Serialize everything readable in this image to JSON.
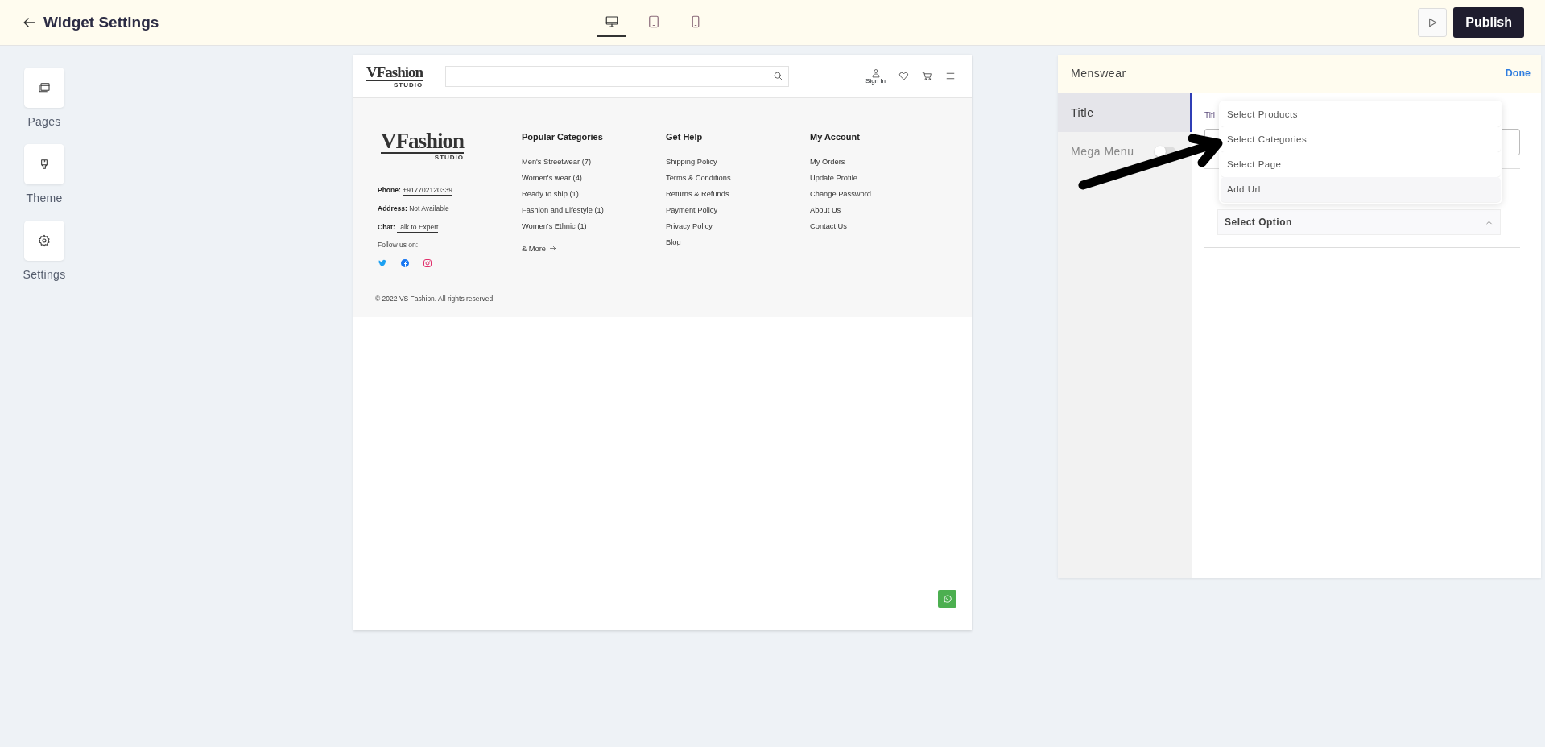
{
  "topbar": {
    "title": "Widget Settings",
    "devices": [
      {
        "kind": "desktop",
        "selected": true
      },
      {
        "kind": "tablet",
        "selected": false
      },
      {
        "kind": "mobile",
        "selected": false
      }
    ],
    "publish": "Publish"
  },
  "sidebar": [
    {
      "kind": "pages",
      "label": "Pages"
    },
    {
      "kind": "theme",
      "label": "Theme"
    },
    {
      "kind": "settings",
      "label": "Settings"
    }
  ],
  "preview": {
    "header_logo": {
      "name": "VFashion",
      "tagline": "STUDIO"
    },
    "sign_in": "Sign In",
    "footer_logo": {
      "name": "VFashion",
      "tagline": "STUDIO"
    },
    "contact": [
      {
        "label": "Phone:",
        "value": "+917702120339",
        "link": true
      },
      {
        "label": "Address:",
        "value": "Not Available",
        "link": false
      },
      {
        "label": "Chat:",
        "value": "Talk to Expert",
        "link": true
      }
    ],
    "follow": "Follow us on:",
    "socials": [
      {
        "kind": "twitter",
        "color": "#1da1f2"
      },
      {
        "kind": "facebook",
        "color": "#1877f2"
      },
      {
        "kind": "instagram",
        "color": "#e1306c"
      }
    ],
    "columns": [
      {
        "title": "Popular Categories",
        "items": [
          "Men's Streetwear (7)",
          "Women's wear (4)",
          "Ready to ship (1)",
          "Fashion and Lifestyle (1)",
          "Women's Ethnic (1)"
        ],
        "more": "& More"
      },
      {
        "title": "Get Help",
        "items": [
          "Shipping Policy",
          "Terms & Conditions",
          "Returns & Refunds",
          "Payment Policy",
          "Privacy Policy",
          "Blog"
        ]
      },
      {
        "title": "My Account",
        "items": [
          "My Orders",
          "Update Profile",
          "Change Password",
          "About Us",
          "Contact Us"
        ]
      }
    ],
    "copyright": "© 2022 VS Fashion. All rights reserved"
  },
  "panel": {
    "title": "Menswear",
    "done": "Done",
    "tabs": [
      {
        "label": "Title",
        "selected": true
      },
      {
        "label": "Mega Menu",
        "selected": false,
        "toggle_on": false
      }
    ],
    "field_label": "Titl",
    "dropdown": [
      {
        "label": "Select Products",
        "hovered": false
      },
      {
        "label": "Select Categories",
        "hovered": false
      },
      {
        "label": "Select Page",
        "hovered": false
      },
      {
        "label": "Add Url",
        "hovered": true
      }
    ],
    "select": {
      "label": "Select Option",
      "expanded": true
    }
  }
}
